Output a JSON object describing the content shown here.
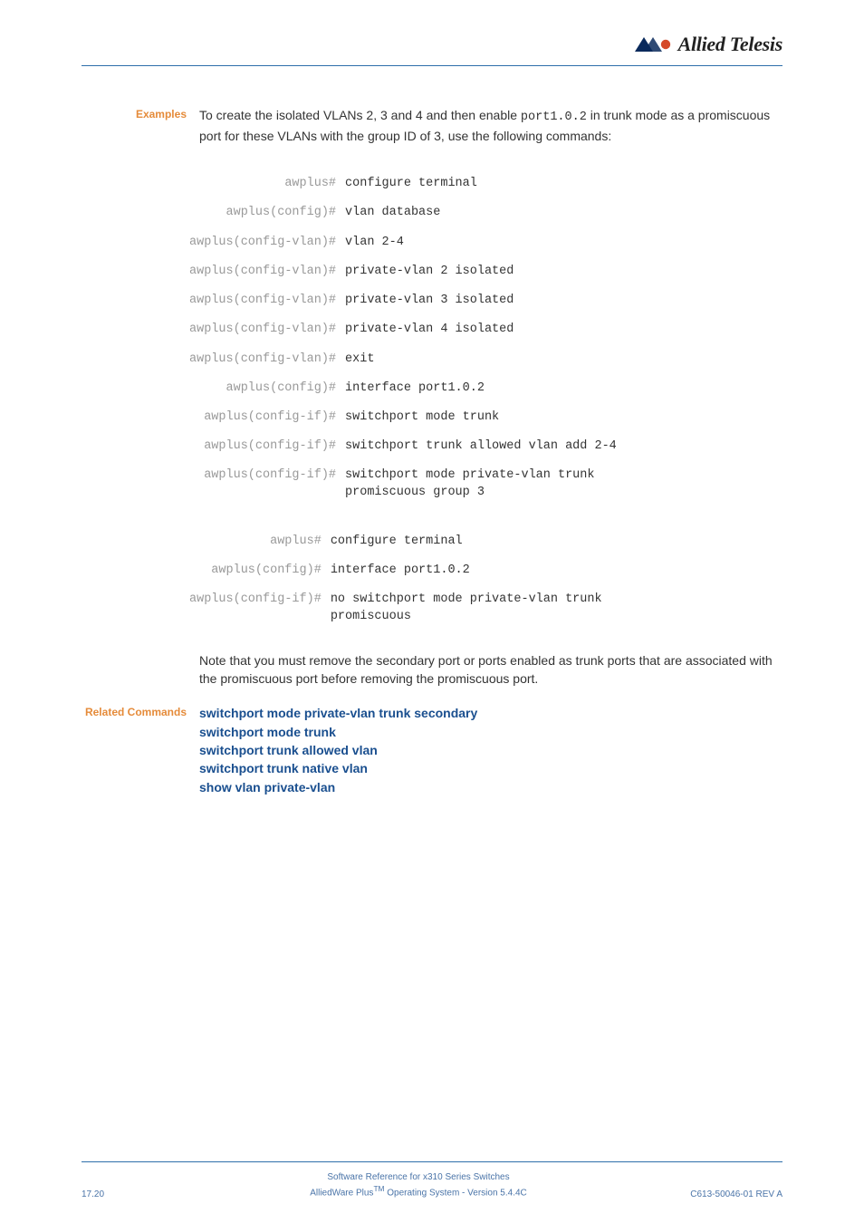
{
  "logo_text": "Allied Telesis",
  "labels": {
    "examples": "Examples",
    "related": "Related Commands"
  },
  "intro_text_1": "To create the isolated VLANs 2, 3 and 4 and then enable ",
  "intro_code": "port1.0.2",
  "intro_text_2": " in trunk mode as a promiscuous port for these VLANs with the group ID of 3, use the following commands:",
  "cmds1": [
    {
      "p": "awplus#",
      "c": "configure terminal"
    },
    {
      "p": "awplus(config)#",
      "c": "vlan database"
    },
    {
      "p": "awplus(config-vlan)#",
      "c": "vlan 2-4"
    },
    {
      "p": "awplus(config-vlan)#",
      "c": "private-vlan 2 isolated"
    },
    {
      "p": "awplus(config-vlan)#",
      "c": "private-vlan 3 isolated"
    },
    {
      "p": "awplus(config-vlan)#",
      "c": "private-vlan 4 isolated"
    },
    {
      "p": "awplus(config-vlan)#",
      "c": "exit"
    },
    {
      "p": "awplus(config)#",
      "c": "interface port1.0.2"
    },
    {
      "p": "awplus(config-if)#",
      "c": "switchport mode trunk"
    },
    {
      "p": "awplus(config-if)#",
      "c": "switchport trunk allowed vlan add 2-4"
    },
    {
      "p": "awplus(config-if)#",
      "c": "switchport mode private-vlan trunk \npromiscuous group 3"
    }
  ],
  "cmds2": [
    {
      "p": "awplus#",
      "c": "configure terminal"
    },
    {
      "p": "awplus(config)#",
      "c": "interface port1.0.2"
    },
    {
      "p": "awplus(config-if)#",
      "c": "no switchport mode private-vlan trunk \npromiscuous"
    }
  ],
  "note": "Note that you must remove the secondary port or ports enabled as trunk ports that are associated with the promiscuous port before removing the promiscuous port.",
  "related_links": [
    "switchport mode private-vlan trunk secondary",
    "switchport mode trunk",
    "switchport trunk allowed vlan",
    "switchport trunk native vlan",
    "show vlan private-vlan"
  ],
  "footer": {
    "page_num": "17.20",
    "line1": "Software Reference for x310 Series Switches",
    "line2_a": "AlliedWare Plus",
    "line2_tm": "TM",
    "line2_b": " Operating System  - Version 5.4.4C",
    "rev": "C613-50046-01 REV A"
  }
}
